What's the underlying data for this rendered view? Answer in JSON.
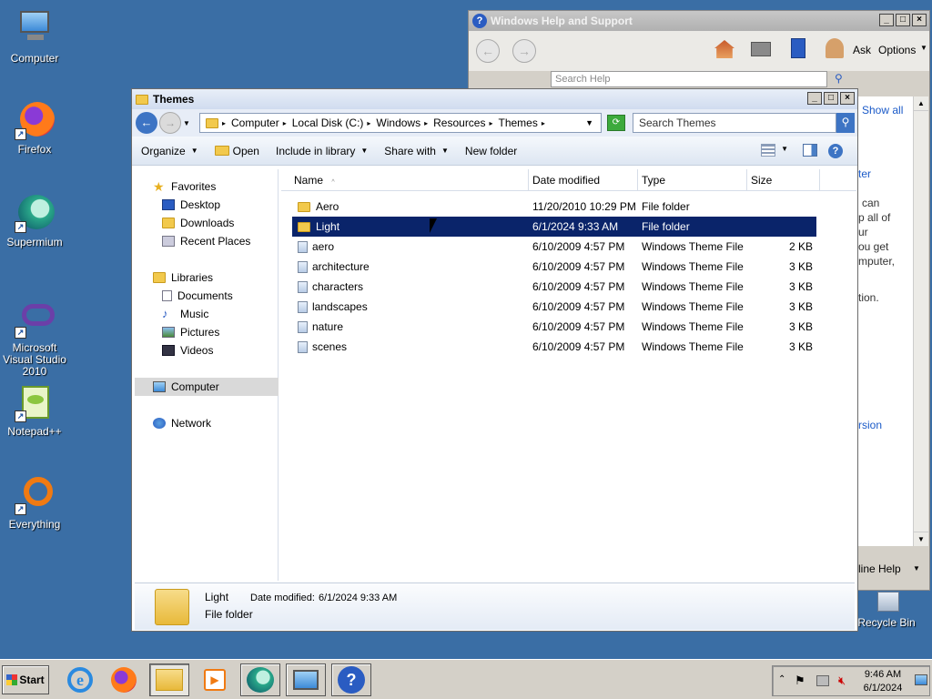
{
  "desktop": {
    "icons": [
      {
        "label": "Computer"
      },
      {
        "label": "Firefox"
      },
      {
        "label": "Supermium"
      },
      {
        "label": "Microsoft Visual Studio 2010"
      },
      {
        "label": "Notepad++"
      },
      {
        "label": "Everything"
      },
      {
        "label": "Recycle Bin"
      }
    ]
  },
  "help_window": {
    "title": "Windows Help and Support",
    "ask_label": "Ask",
    "options_label": "Options",
    "search_placeholder": "Search Help",
    "fragments": [
      "Show all",
      "ter",
      "can",
      "p all of",
      "ur",
      "ou get",
      "mputer,",
      "tion.",
      "rsion",
      "line Help"
    ]
  },
  "explorer": {
    "title": "Themes",
    "breadcrumb": [
      "Computer",
      "Local Disk (C:)",
      "Windows",
      "Resources",
      "Themes"
    ],
    "search_placeholder": "Search Themes",
    "commands": {
      "organize": "Organize",
      "open": "Open",
      "include": "Include in library",
      "share": "Share with",
      "new_folder": "New folder"
    },
    "nav": {
      "favorites": "Favorites",
      "desktop": "Desktop",
      "downloads": "Downloads",
      "recent": "Recent Places",
      "libraries": "Libraries",
      "documents": "Documents",
      "music": "Music",
      "pictures": "Pictures",
      "videos": "Videos",
      "computer": "Computer",
      "network": "Network"
    },
    "columns": {
      "name": "Name",
      "date": "Date modified",
      "type": "Type",
      "size": "Size"
    },
    "files": [
      {
        "name": "Aero",
        "date": "11/20/2010 10:29 PM",
        "type": "File folder",
        "size": ""
      },
      {
        "name": "Light",
        "date": "6/1/2024 9:33 AM",
        "type": "File folder",
        "size": ""
      },
      {
        "name": "aero",
        "date": "6/10/2009 4:57 PM",
        "type": "Windows Theme File",
        "size": "2 KB"
      },
      {
        "name": "architecture",
        "date": "6/10/2009 4:57 PM",
        "type": "Windows Theme File",
        "size": "3 KB"
      },
      {
        "name": "characters",
        "date": "6/10/2009 4:57 PM",
        "type": "Windows Theme File",
        "size": "3 KB"
      },
      {
        "name": "landscapes",
        "date": "6/10/2009 4:57 PM",
        "type": "Windows Theme File",
        "size": "3 KB"
      },
      {
        "name": "nature",
        "date": "6/10/2009 4:57 PM",
        "type": "Windows Theme File",
        "size": "3 KB"
      },
      {
        "name": "scenes",
        "date": "6/10/2009 4:57 PM",
        "type": "Windows Theme File",
        "size": "3 KB"
      }
    ],
    "details": {
      "name": "Light",
      "date_label": "Date modified:",
      "date_value": "6/1/2024 9:33 AM",
      "type": "File folder"
    }
  },
  "taskbar": {
    "start_label": "Start",
    "time": "9:46 AM",
    "date": "6/1/2024"
  }
}
